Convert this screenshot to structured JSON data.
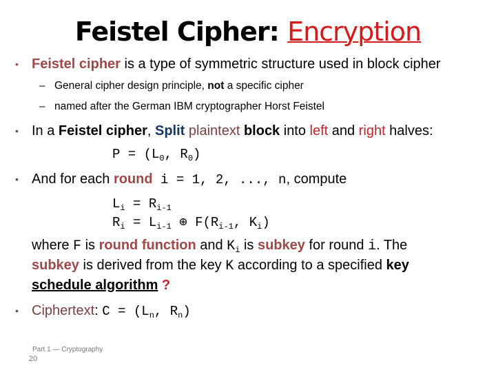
{
  "slide": {
    "title_main": "Feistel Cipher",
    "title_sep": ": ",
    "title_sub": "Encryption",
    "bullet1": {
      "term": "Feistel cipher",
      "rest": " is a type of symmetric structure used in block cipher",
      "sub1_pre": "General cipher design principle, ",
      "sub1_bold": "not",
      "sub1_post": " a specific cipher",
      "sub2": "named after the German IBM cryptographer Horst Feistel"
    },
    "bullet2": {
      "pre": "In a ",
      "term": "Feistel cipher",
      "comma": ", ",
      "split": "Split",
      "plaintext": " plaintext",
      "block": " block",
      "into": " into ",
      "left": "left",
      "and": " and ",
      "right": "right",
      "halves": " halves:",
      "formula_p": "P = (L",
      "formula_sub0a": "0",
      "formula_mid": ", R",
      "formula_sub0b": "0",
      "formula_end": ")"
    },
    "bullet3": {
      "pre": "And for each ",
      "round": "round",
      "expr": " i = 1, 2, ..., n",
      "post": ", compute",
      "eq1_a": "L",
      "eq1_sub_a": "i",
      "eq1_b": " = R",
      "eq1_sub_b": "i-1",
      "eq2_a": "R",
      "eq2_sub_a": "i",
      "eq2_b": " = L",
      "eq2_sub_b": "i-1",
      "eq2_op": " ⊕ F(R",
      "eq2_sub_c": "i-1",
      "eq2_c": ", K",
      "eq2_sub_d": "i",
      "eq2_end": ")",
      "where": "where ",
      "F": "F",
      "is": " is ",
      "round_function": "round function",
      "and": " and ",
      "K": "K",
      "K_sub": "i",
      "is2": " is ",
      "subkey": "subkey",
      "for_round": " for round ",
      "i": "i",
      "the": ". The",
      "subkey2": "subkey",
      "derived": " is derived from the key ",
      "K2": "K",
      "according": " according to a specified ",
      "key": "key",
      "schedule": "schedule algorithm",
      "qmark": " ?"
    },
    "bullet4": {
      "label": "Ciphertext",
      "colon": ": ",
      "formula_a": "C = (L",
      "sub_a": "n",
      "formula_b": ", R",
      "sub_b": "n",
      "formula_end": ")"
    },
    "footer": {
      "caption": "Part 1 — Cryptography",
      "page_number": "20"
    }
  }
}
